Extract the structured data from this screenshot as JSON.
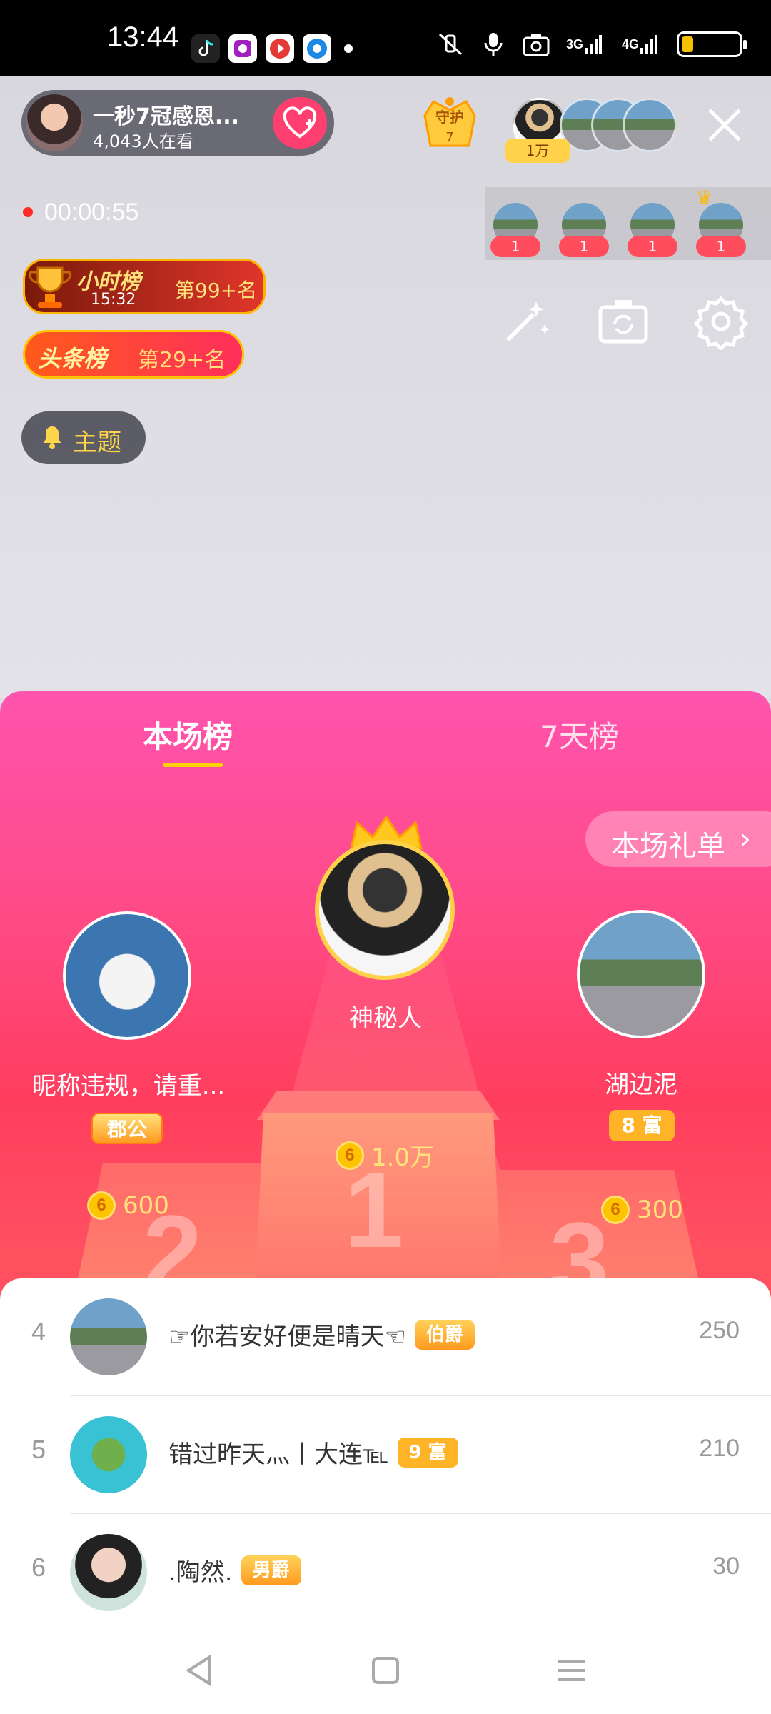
{
  "status_bar": {
    "time": "13:44",
    "icons": [
      "tiktok-icon",
      "app-icon",
      "video-icon",
      "browser-icon",
      "mute-icon",
      "mic-icon",
      "camera-icon"
    ],
    "signal_3g": "3G",
    "signal_4g": "4G",
    "battery_level": 0.2
  },
  "host": {
    "name": "一秒7冠感恩...",
    "viewers": "4,043人在看"
  },
  "guard": {
    "label": "守护",
    "count": "7"
  },
  "viewer_tag": "1万",
  "timer": "00:00:55",
  "mini_users": [
    "1",
    "1",
    "1",
    "1"
  ],
  "hour_rank": {
    "title": "小时榜",
    "time": "15:32",
    "rank": "第99+名"
  },
  "head_rank": {
    "title": "头条榜",
    "rank": "第29+名"
  },
  "theme_button": "主题",
  "tabs": {
    "active": "本场榜",
    "inactive": "7天榜"
  },
  "gift_list_button": "本场礼单",
  "podium": {
    "first": {
      "name": "神秘人",
      "score": "1.0万"
    },
    "second": {
      "name": "昵称违规，请重...",
      "badge": "郡公",
      "score": "600"
    },
    "third": {
      "name": "湖边泥",
      "badge": "8 富",
      "score": "300"
    }
  },
  "coin_glyph": "6",
  "numbers": {
    "first": "1",
    "second": "2",
    "third": "3"
  },
  "list": [
    {
      "rank": "4",
      "name": "☞你若安好便是晴天☜",
      "badge": "伯爵",
      "score": "250"
    },
    {
      "rank": "5",
      "name": "错过昨天灬丨大连℡",
      "badge": "9 富",
      "score": "210"
    },
    {
      "rank": "6",
      "name": ".陶然.",
      "badge": "男爵",
      "score": "30"
    }
  ],
  "colors": {
    "accent_pink": "#ff4a86",
    "gold": "#ffd200"
  }
}
